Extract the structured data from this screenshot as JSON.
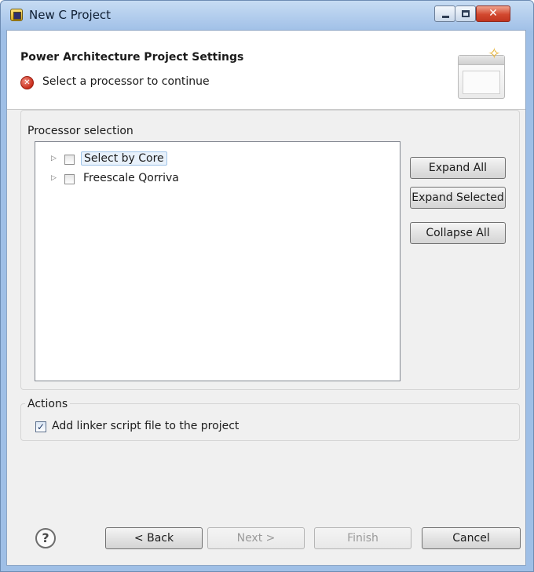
{
  "window": {
    "title": "New C Project",
    "controls": {
      "close_glyph": "✕"
    }
  },
  "banner": {
    "title": "Power Architecture Project Settings",
    "message": "Select a processor to continue",
    "error_glyph": "✕"
  },
  "processor_selection": {
    "label": "Processor selection",
    "tree": [
      {
        "label": "Select by Core",
        "checked": false,
        "selected": true
      },
      {
        "label": "Freescale Qorriva",
        "checked": false,
        "selected": false
      }
    ],
    "buttons": {
      "expand_all": "Expand All",
      "expand_selected": "Expand Selected",
      "collapse_all": "Collapse All"
    }
  },
  "actions": {
    "label": "Actions",
    "add_linker_script": {
      "label": "Add linker script file to the project",
      "checked": true,
      "check_glyph": "✓"
    }
  },
  "footer": {
    "help_glyph": "?",
    "back": "< Back",
    "next": "Next >",
    "finish": "Finish",
    "cancel": "Cancel"
  }
}
